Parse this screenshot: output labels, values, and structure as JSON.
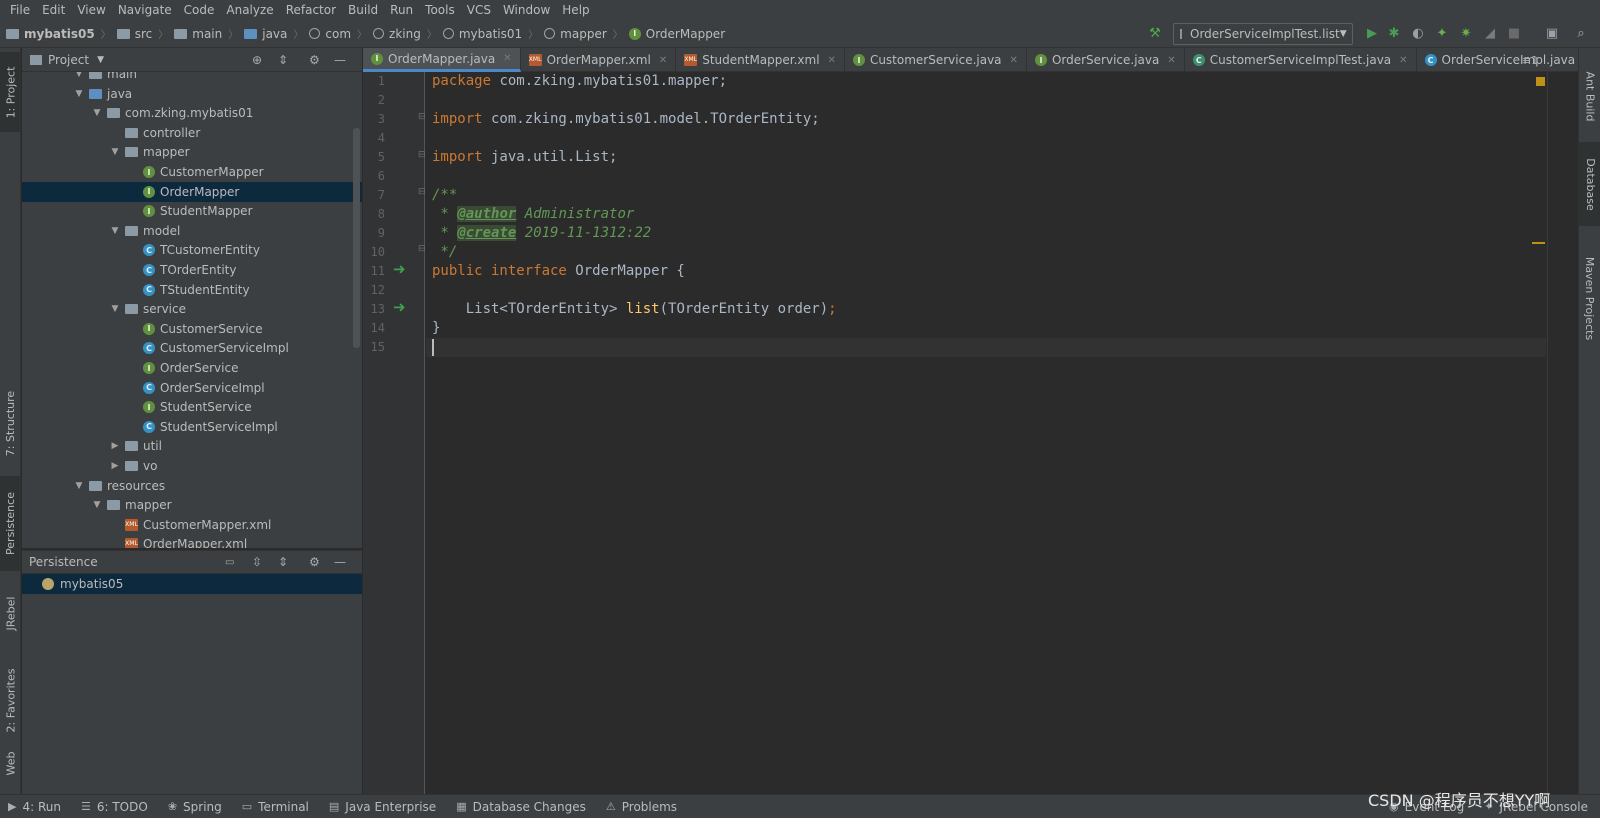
{
  "menu": [
    "File",
    "Edit",
    "View",
    "Navigate",
    "Code",
    "Analyze",
    "Refactor",
    "Build",
    "Run",
    "Tools",
    "VCS",
    "Window",
    "Help"
  ],
  "breadcrumb": [
    "mybatis05",
    "src",
    "main",
    "java",
    "com",
    "zking",
    "mybatis01",
    "mapper",
    "OrderMapper"
  ],
  "run_config": "OrderServiceImplTest.list",
  "project_panel": {
    "title": "Project"
  },
  "tree": [
    {
      "label": "main",
      "indent": 3,
      "type": "folder",
      "arrow": "down"
    },
    {
      "label": "java",
      "indent": 3,
      "type": "folder-blue",
      "arrow": "down"
    },
    {
      "label": "com.zking.mybatis01",
      "indent": 4,
      "type": "package",
      "arrow": "down"
    },
    {
      "label": "controller",
      "indent": 5,
      "type": "package",
      "arrow": ""
    },
    {
      "label": "mapper",
      "indent": 5,
      "type": "package",
      "arrow": "down"
    },
    {
      "label": "CustomerMapper",
      "indent": 6,
      "type": "interface",
      "arrow": ""
    },
    {
      "label": "OrderMapper",
      "indent": 6,
      "type": "interface",
      "arrow": "",
      "selected": true
    },
    {
      "label": "StudentMapper",
      "indent": 6,
      "type": "interface",
      "arrow": ""
    },
    {
      "label": "model",
      "indent": 5,
      "type": "package",
      "arrow": "down"
    },
    {
      "label": "TCustomerEntity",
      "indent": 6,
      "type": "class",
      "arrow": ""
    },
    {
      "label": "TOrderEntity",
      "indent": 6,
      "type": "class",
      "arrow": ""
    },
    {
      "label": "TStudentEntity",
      "indent": 6,
      "type": "class",
      "arrow": ""
    },
    {
      "label": "service",
      "indent": 5,
      "type": "package",
      "arrow": "down"
    },
    {
      "label": "CustomerService",
      "indent": 6,
      "type": "interface",
      "arrow": ""
    },
    {
      "label": "CustomerServiceImpl",
      "indent": 6,
      "type": "class",
      "arrow": ""
    },
    {
      "label": "OrderService",
      "indent": 6,
      "type": "interface",
      "arrow": ""
    },
    {
      "label": "OrderServiceImpl",
      "indent": 6,
      "type": "class",
      "arrow": ""
    },
    {
      "label": "StudentService",
      "indent": 6,
      "type": "interface",
      "arrow": ""
    },
    {
      "label": "StudentServiceImpl",
      "indent": 6,
      "type": "class",
      "arrow": ""
    },
    {
      "label": "util",
      "indent": 5,
      "type": "package",
      "arrow": "right"
    },
    {
      "label": "vo",
      "indent": 5,
      "type": "package",
      "arrow": "right"
    },
    {
      "label": "resources",
      "indent": 3,
      "type": "folder",
      "arrow": "down"
    },
    {
      "label": "mapper",
      "indent": 4,
      "type": "folder",
      "arrow": "down"
    },
    {
      "label": "CustomerMapper.xml",
      "indent": 5,
      "type": "xml",
      "arrow": ""
    },
    {
      "label": "OrderMapper.xml",
      "indent": 5,
      "type": "xml",
      "arrow": ""
    }
  ],
  "persistence": {
    "title": "Persistence",
    "item": "mybatis05"
  },
  "tabs": [
    {
      "label": "OrderMapper.java",
      "type": "interface",
      "active": true
    },
    {
      "label": "OrderMapper.xml",
      "type": "xml"
    },
    {
      "label": "StudentMapper.xml",
      "type": "xml"
    },
    {
      "label": "CustomerService.java",
      "type": "interface"
    },
    {
      "label": "OrderService.java",
      "type": "interface"
    },
    {
      "label": "CustomerServiceImplTest.java",
      "type": "test"
    },
    {
      "label": "OrderServiceImpl.java",
      "type": "class"
    }
  ],
  "tab_overflow": "≡1",
  "line_numbers": [
    "1",
    "2",
    "3",
    "4",
    "5",
    "6",
    "7",
    "8",
    "9",
    "10",
    "11",
    "12",
    "13",
    "14",
    "15"
  ],
  "code": {
    "l1_kw": "package",
    "l1_rest": " com.zking.mybatis01.mapper;",
    "l3_kw": "import",
    "l3_rest": " com.zking.mybatis01.model.TOrderEntity;",
    "l5_kw": "import",
    "l5_rest": " java.util.List;",
    "l7": "/**",
    "l8_pre": " * ",
    "l8_tag": "@author",
    "l8_rest": " Administrator",
    "l9_pre": " * ",
    "l9_tag": "@create",
    "l9_rest": " 2019-11-1312:22",
    "l10": " */",
    "l11_kw": "public interface",
    "l11_rest": " OrderMapper {",
    "l13_a": "    List<TOrderEntity> ",
    "l13_fn": "list",
    "l13_b": "(TOrderEntity order)",
    "l13_semi": ";",
    "l14": "}"
  },
  "left_vtabs": [
    "1: Project",
    "7: Structure",
    "Persistence",
    "JRebel",
    "2: Favorites",
    "Web"
  ],
  "right_vtabs": [
    "Ant Build",
    "Database",
    "Maven Projects"
  ],
  "status": [
    "4: Run",
    "6: TODO",
    "Spring",
    "Terminal",
    "Java Enterprise",
    "Database Changes",
    "Problems",
    "Event Log",
    "JRebel Console"
  ],
  "watermark": "CSDN @程序员不想YY啊",
  "colors": {
    "keyword": "#cc7832",
    "comment": "#629755",
    "function": "#ffc66d",
    "text": "#a9b7c6",
    "accent": "#4a88c7"
  }
}
